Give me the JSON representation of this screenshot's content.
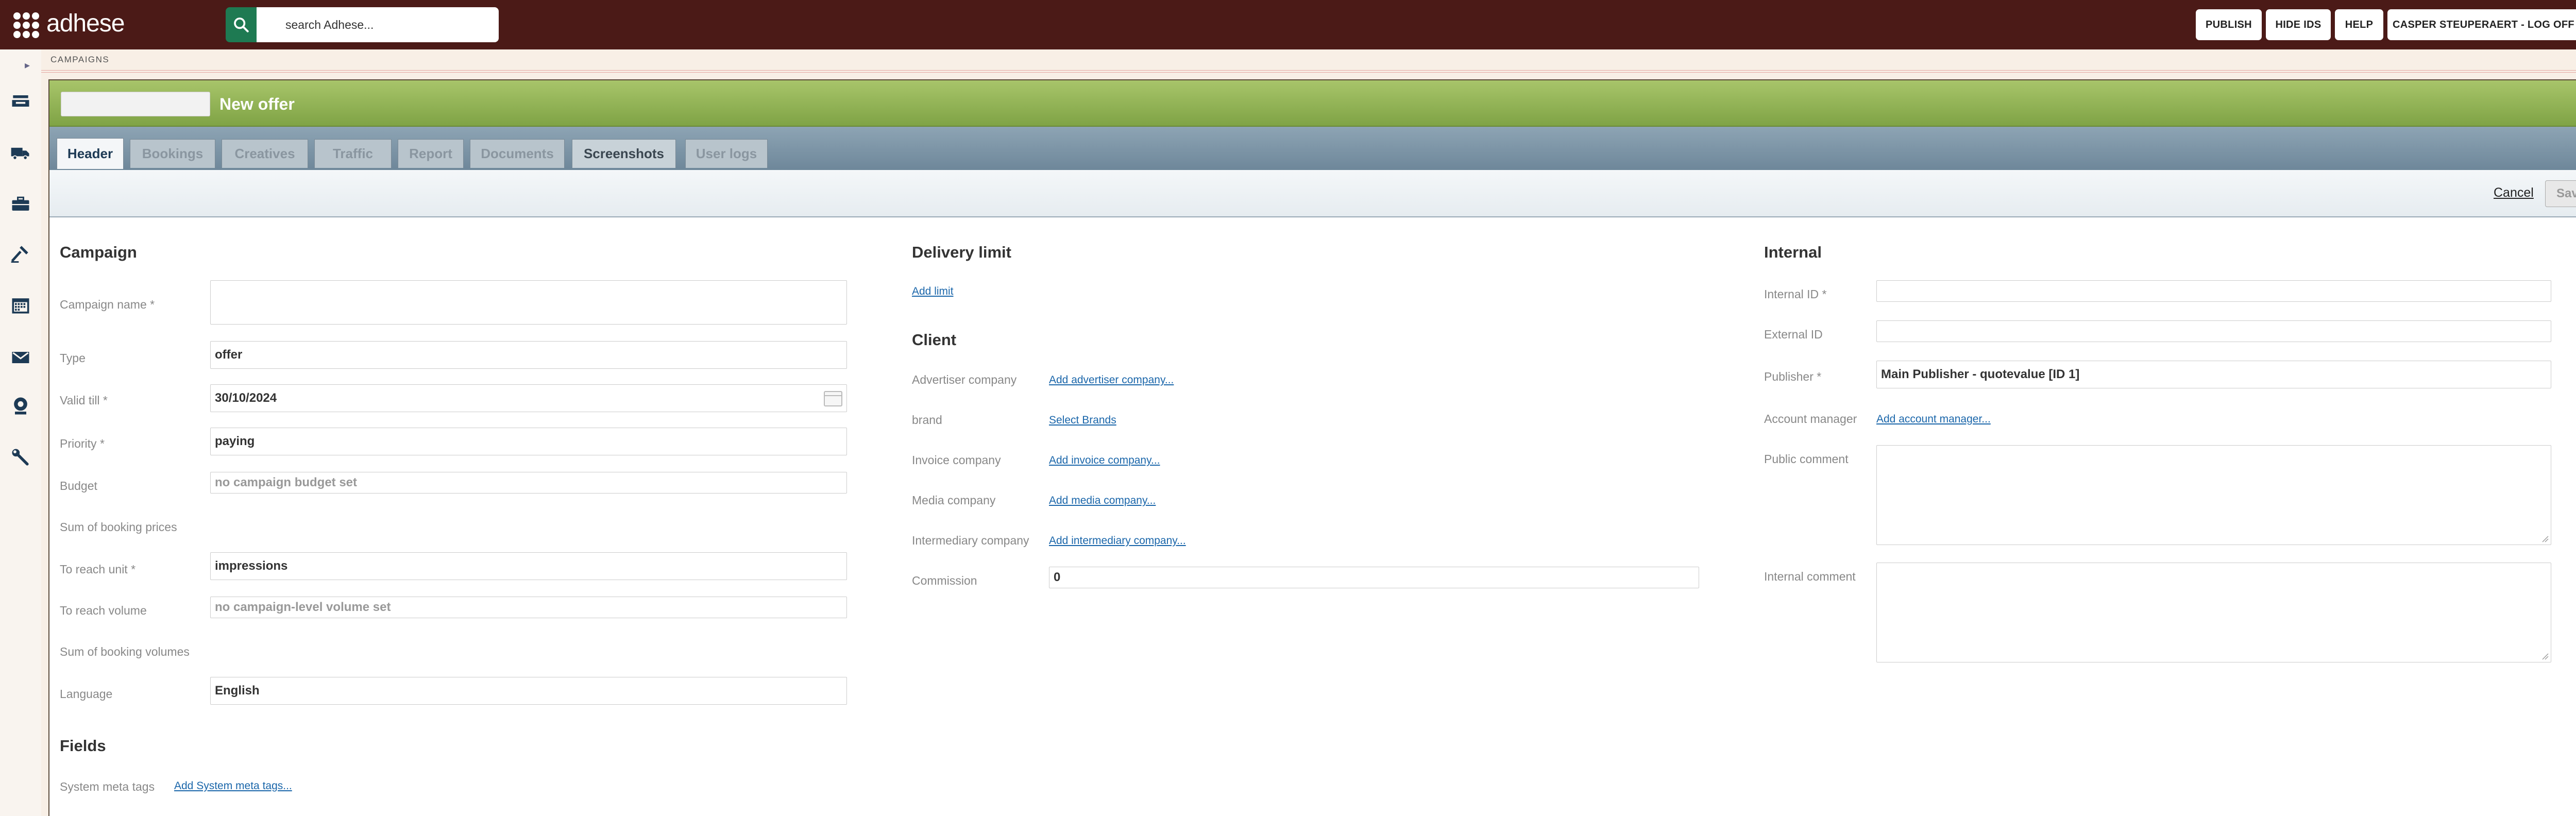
{
  "app": {
    "name": "adhese"
  },
  "search": {
    "placeholder": "search Adhese..."
  },
  "topbar": {
    "publish_label": "PUBLISH",
    "hide_ids_label": "HIDE IDS",
    "help_label": "HELP",
    "user_label": "CASPER STEUPERAERT - LOG OFF"
  },
  "breadcrumb": {
    "label": "CAMPAIGNS"
  },
  "panel": {
    "title": "New offer"
  },
  "tabs": [
    {
      "label": "Header"
    },
    {
      "label": "Bookings"
    },
    {
      "label": "Creatives"
    },
    {
      "label": "Traffic"
    },
    {
      "label": "Report"
    },
    {
      "label": "Documents"
    },
    {
      "label": "Screenshots"
    },
    {
      "label": "User logs"
    }
  ],
  "actions": {
    "cancel_label": "Cancel",
    "save_label": "Save",
    "save_caret": "▼"
  },
  "campaign": {
    "heading": "Campaign",
    "name_label": "Campaign name *",
    "name_value": "",
    "type_label": "Type",
    "type_value": "offer",
    "valid_label": "Valid till *",
    "valid_value": "30/10/2024",
    "priority_label": "Priority *",
    "priority_value": "paying",
    "budget_label": "Budget",
    "budget_placeholder": "no campaign budget set",
    "sum_prices_label": "Sum of booking prices",
    "reach_unit_label": "To reach unit *",
    "reach_unit_value": "impressions",
    "reach_volume_label": "To reach volume",
    "reach_volume_placeholder": "no campaign-level volume set",
    "sum_volumes_label": "Sum of booking volumes",
    "language_label": "Language",
    "language_value": "English"
  },
  "fields": {
    "heading": "Fields",
    "meta_label": "System meta tags",
    "meta_link": "Add System meta tags..."
  },
  "delivery": {
    "heading": "Delivery limit",
    "add_link": "Add limit"
  },
  "client": {
    "heading": "Client",
    "advertiser_label": "Advertiser company",
    "advertiser_link": "Add advertiser company...",
    "brand_label": "brand",
    "brand_link": "Select Brands",
    "invoice_label": "Invoice company",
    "invoice_link": "Add invoice company...",
    "media_label": "Media company",
    "media_link": "Add media company...",
    "intermediary_label": "Intermediary company",
    "intermediary_link": "Add intermediary company...",
    "commission_label": "Commission",
    "commission_value": "0"
  },
  "internal": {
    "heading": "Internal",
    "internal_id_label": "Internal ID *",
    "external_id_label": "External ID",
    "publisher_label": "Publisher *",
    "publisher_value": "Main Publisher - quotevalue [ID 1]",
    "account_label": "Account manager",
    "account_link": "Add account manager...",
    "public_comment_label": "Public comment",
    "internal_comment_label": "Internal comment"
  },
  "colors": {
    "topbar": "#4b1a17",
    "search_button": "#1e7a52",
    "panel_header": "#8fb052",
    "link": "#1a66aa"
  }
}
